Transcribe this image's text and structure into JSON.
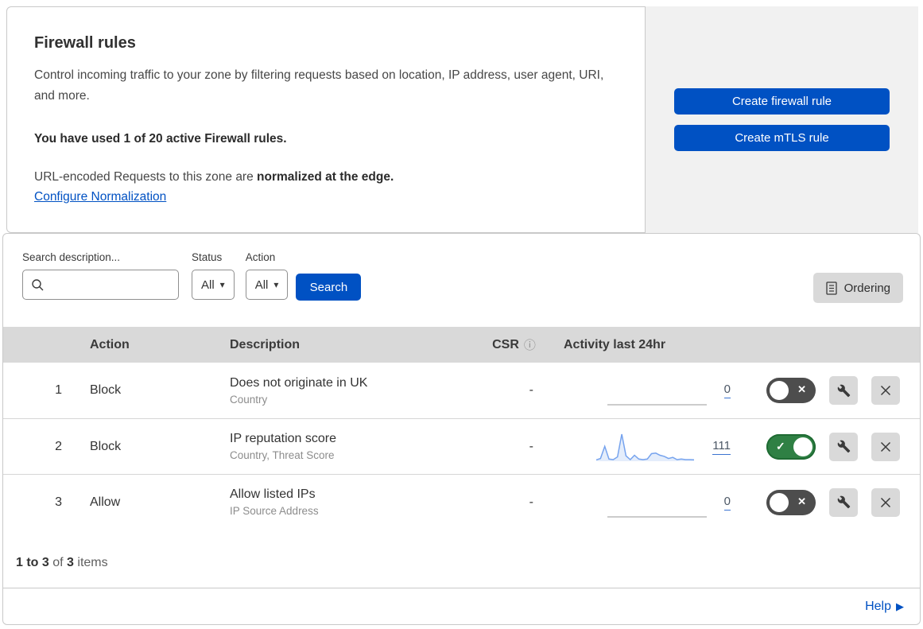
{
  "colors": {
    "accent_blue": "#0051c3",
    "toggle_on_green": "#2f8044",
    "toggle_off_gray": "#4d4d4d",
    "header_row_gray": "#d9d9d9",
    "panel_gray": "#f1f1f1",
    "sparkline_blue": "#76a3ee",
    "sparkline_fill": "#e4edfb",
    "flatline_gray": "#9a9a9a"
  },
  "icons": {
    "dropdown_caret": "▾",
    "info": "ⓘ",
    "help_arrow": "▶",
    "toggle_on_check": "✓",
    "toggle_off_x": "✕"
  },
  "header": {
    "title": "Firewall rules",
    "description": "Control incoming traffic to your zone by filtering requests based on location, IP address, user agent, URI, and more.",
    "usage": "You have used 1 of 20 active Firewall rules.",
    "normalization_prefix": "URL-encoded Requests to this zone are ",
    "normalization_bold": "normalized at the edge.",
    "normalization_link": "Configure Normalization",
    "buttons": {
      "create_firewall_rule": "Create firewall rule",
      "create_mtls_rule": "Create mTLS rule"
    }
  },
  "filters": {
    "search_label": "Search description...",
    "search_input_value": "",
    "status_label": "Status",
    "status_value": "All",
    "action_label": "Action",
    "action_value": "All",
    "search_button": "Search",
    "ordering_button": "Ordering"
  },
  "table": {
    "columns": {
      "action": "Action",
      "description": "Description",
      "csr": "CSR",
      "activity": "Activity last 24hr"
    },
    "rows": [
      {
        "index": "1",
        "action": "Block",
        "description": "Does not originate in UK",
        "fields": "Country",
        "csr": "-",
        "activity_count": "0",
        "enabled": false,
        "sparkline": null
      },
      {
        "index": "2",
        "action": "Block",
        "description": "IP reputation score",
        "fields": "Country, Threat Score",
        "csr": "-",
        "activity_count": "111",
        "enabled": true,
        "sparkline": [
          5,
          10,
          55,
          8,
          6,
          16,
          100,
          20,
          6,
          22,
          8,
          6,
          8,
          28,
          30,
          22,
          18,
          10,
          14,
          6,
          8,
          6,
          6,
          5
        ]
      },
      {
        "index": "3",
        "action": "Allow",
        "description": "Allow listed IPs",
        "fields": "IP Source Address",
        "csr": "-",
        "activity_count": "0",
        "enabled": false,
        "sparkline": null
      }
    ]
  },
  "footer": {
    "range_bold": "1 to 3",
    "of_text": " of ",
    "total_bold": "3",
    "items_text": " items",
    "help_label": "Help"
  }
}
